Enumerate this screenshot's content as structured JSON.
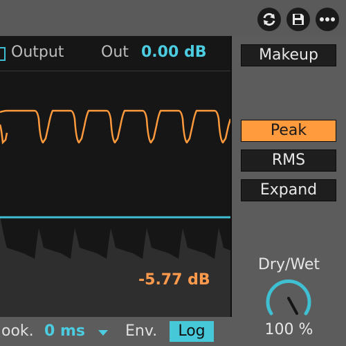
{
  "header": {
    "icons": [
      "hot-swap-icon",
      "save-preset-icon",
      "more-options-icon"
    ]
  },
  "display": {
    "output_label": "Output",
    "out_prefix": "Out",
    "out_value": "0.00 dB",
    "gain_reduction": "-5.77 dB",
    "colors": {
      "input_waveform": "#ff9a3d",
      "threshold_line": "#3fbfd2",
      "gain_reduction_fill": "#2e2e2e"
    }
  },
  "bottom": {
    "lookahead_label": "ook.",
    "lookahead_value": "0 ms",
    "env_label": "Env.",
    "env_mode": "Log"
  },
  "sidebar": {
    "makeup": "Makeup",
    "modes": [
      {
        "label": "Peak",
        "active": true
      },
      {
        "label": "RMS",
        "active": false
      },
      {
        "label": "Expand",
        "active": false
      }
    ],
    "drywet_label": "Dry/Wet",
    "drywet_value": "100 %"
  }
}
